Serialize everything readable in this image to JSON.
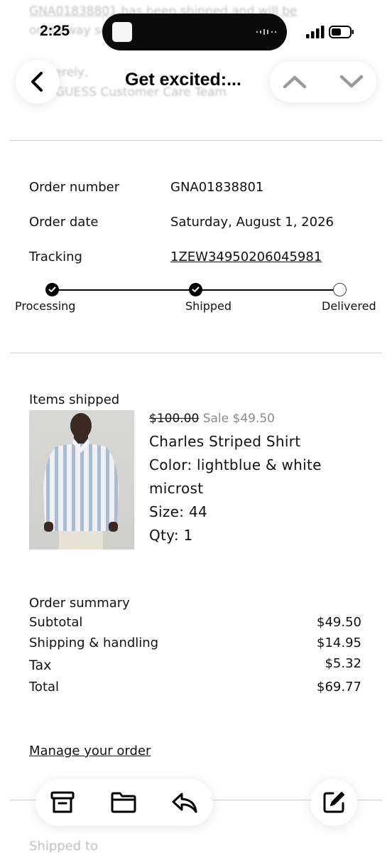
{
  "status_bar": {
    "time": "2:25"
  },
  "background_text": {
    "line1": "GNA01838801 has been shipped and will be",
    "line2": "on its way soon.",
    "line3": "Sincerely,",
    "line4": "The GUESS Customer Care Team"
  },
  "header": {
    "title": "Get excited:..."
  },
  "order": {
    "number_label": "Order number",
    "number_value": "GNA01838801",
    "date_label": "Order date",
    "date_value": "Saturday, August 1, 2026",
    "tracking_label": "Tracking",
    "tracking_value": "1ZEW34950206045981"
  },
  "tracker": {
    "steps": [
      {
        "label": "Processing",
        "done": true
      },
      {
        "label": "Shipped",
        "done": true
      },
      {
        "label": "Delivered",
        "done": false
      }
    ]
  },
  "items": {
    "title": "Items shipped",
    "product": {
      "original_price": "$100.00",
      "sale_price": "Sale $49.50",
      "name": "Charles Striped Shirt",
      "color_line1": "Color: lightblue & white",
      "color_line2": "microst",
      "size": "Size: 44",
      "qty": "Qty: 1"
    }
  },
  "summary": {
    "title": "Order summary",
    "rows": [
      {
        "label": "Subtotal",
        "value": "$49.50"
      },
      {
        "label": "Shipping & handling",
        "value": "$14.95"
      },
      {
        "label": "Tax",
        "value": "$5.32"
      },
      {
        "label": "Total",
        "value": "$69.77"
      }
    ]
  },
  "links": {
    "manage_order": "Manage your order"
  },
  "footer": {
    "shipped_to": "Shipped to"
  },
  "icons": {
    "back": "chevron-left-icon",
    "up": "chevron-up-icon",
    "down": "chevron-down-icon",
    "archive": "archive-icon",
    "folder": "folder-icon",
    "reply": "reply-icon",
    "compose": "compose-icon"
  },
  "colors": {
    "text": "#111111",
    "muted": "#8a8a8a",
    "divider": "#d0d0d0",
    "nav_disabled": "#9a9a9a"
  }
}
